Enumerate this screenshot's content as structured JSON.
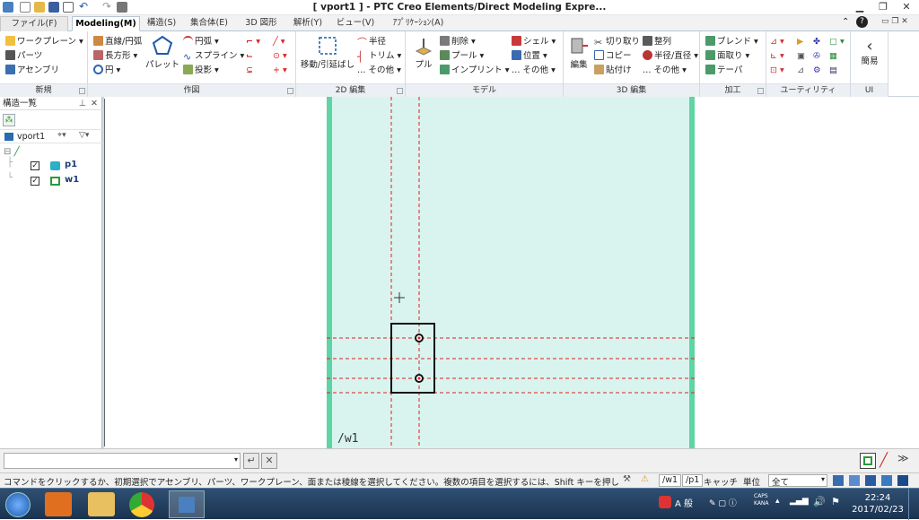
{
  "window": {
    "title": "[ vport1 ] - PTC Creo Elements/Direct Modeling Expre..."
  },
  "tabs": [
    "ファイル(F)",
    "Modeling(M)",
    "構造(S)",
    "集合体(E)",
    "3D 図形",
    "解析(Y)",
    "ビュー(V)",
    "ｱﾌﾟﾘｹｰｼｮﾝ(A)"
  ],
  "ribbon": {
    "new": {
      "label": "新規",
      "items": [
        "ワークプレーン",
        "パーツ",
        "アセンブリ"
      ]
    },
    "draw": {
      "label": "作図",
      "items": [
        "直線/円弧",
        "長方形",
        "円",
        "パレット",
        "円弧",
        "スプライン",
        "投影"
      ]
    },
    "edit2d": {
      "label": "2D 編集",
      "items": [
        "移動/引延ばし",
        "半径",
        "トリム",
        "その他"
      ]
    },
    "model": {
      "label": "モデル",
      "items": [
        "プル",
        "削除",
        "プール",
        "インプリント",
        "シェル",
        "位置",
        "その他"
      ]
    },
    "edit3d": {
      "label": "3D 編集",
      "items": [
        "編集",
        "切り取り",
        "コピー",
        "貼付け",
        "整列",
        "半径/直径",
        "その他"
      ]
    },
    "machining": {
      "label": "加工",
      "items": [
        "ブレンド",
        "面取り",
        "テーパ"
      ]
    },
    "utility": {
      "label": "ユーティリティ"
    },
    "ui": {
      "label": "UI",
      "items": [
        "簡易"
      ]
    }
  },
  "sidebar": {
    "header": "構造一覧",
    "viewport": "vport1",
    "tree": [
      {
        "name": "p1",
        "checked": true,
        "icon": "part-icon"
      },
      {
        "name": "w1",
        "checked": true,
        "icon": "workplane-icon"
      }
    ]
  },
  "viewport": {
    "workplane_label": "/w1"
  },
  "cmdbar": {
    "input_value": ""
  },
  "statusbar": {
    "message": "コマンドをクリックするか、初期選択でアセンブリ、パーツ、ワークプレーン、面または稜線を選択してください。複数の項目を選択するには、Shift キーを押します",
    "wp": "/w1",
    "part": "/p1",
    "catch": "キャッチ",
    "unit": "単位",
    "filter": "全て"
  },
  "taskbar": {
    "time": "22:24",
    "date": "2017/02/23",
    "ime": "A 般"
  },
  "colors": {
    "accent": "#1e6bb8",
    "workplane": "#d9f4ef",
    "workplane_edge": "#5fd4a4",
    "guide": "#e02020"
  }
}
